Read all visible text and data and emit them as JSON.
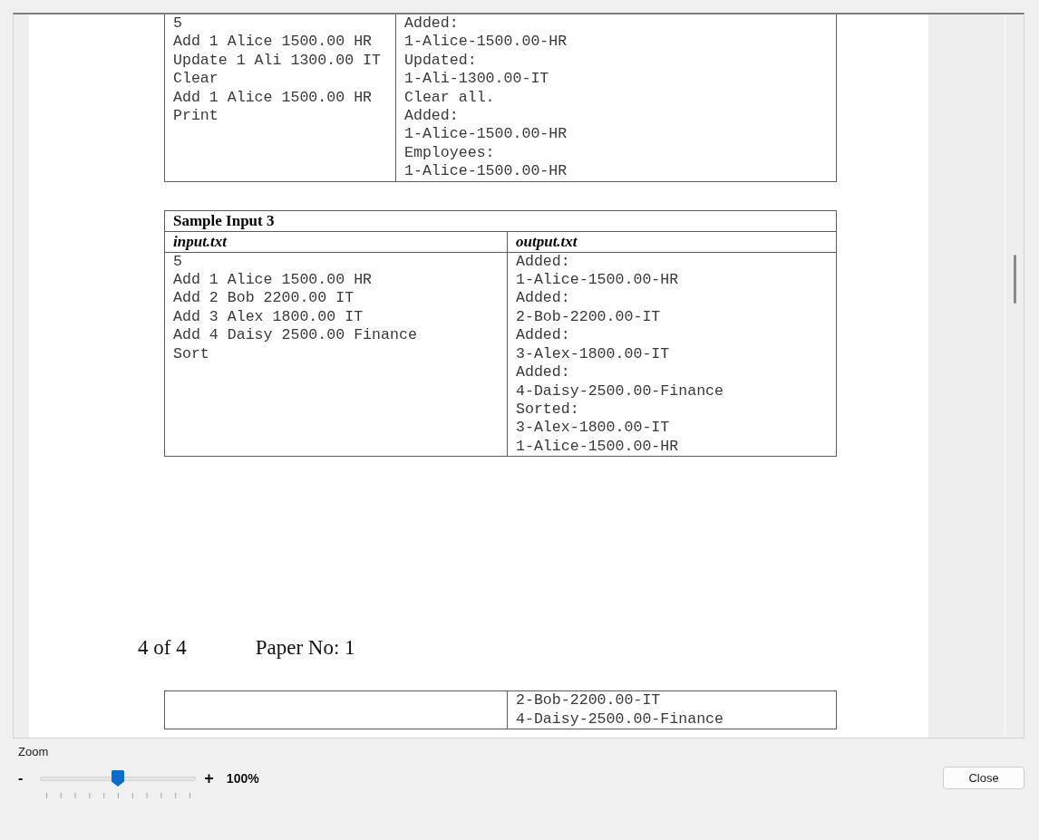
{
  "document": {
    "blocks": [
      {
        "kind": "table",
        "rows": [
          {
            "kind": "body",
            "cells": [
              {
                "lines": [
                  "5",
                  "Add 1 Alice 1500.00 HR",
                  "Update 1 Ali 1300.00 IT",
                  "Clear",
                  "Add 1 Alice 1500.00 HR",
                  "Print"
                ]
              },
              {
                "lines": [
                  "Added:",
                  "1-Alice-1500.00-HR",
                  "Updated:",
                  "1-Ali-1300.00-IT",
                  "Clear all.",
                  "Added:",
                  "1-Alice-1500.00-HR",
                  "Employees:",
                  "1-Alice-1500.00-HR"
                ]
              }
            ]
          }
        ]
      },
      {
        "kind": "table",
        "rows": [
          {
            "kind": "title",
            "text": "Sample Input 3"
          },
          {
            "kind": "header",
            "cells": [
              "input.txt",
              "output.txt"
            ]
          },
          {
            "kind": "body",
            "cells": [
              {
                "lines": [
                  "5",
                  "Add 1 Alice 1500.00 HR",
                  "Add 2 Bob 2200.00 IT",
                  "Add 3 Alex 1800.00 IT",
                  "Add 4 Daisy 2500.00 Finance",
                  "Sort"
                ]
              },
              {
                "lines": [
                  "Added:",
                  "1-Alice-1500.00-HR",
                  "Added:",
                  "2-Bob-2200.00-IT",
                  "Added:",
                  "3-Alex-1800.00-IT",
                  "Added:",
                  "4-Daisy-2500.00-Finance",
                  "Sorted:",
                  "3-Alex-1800.00-IT",
                  "1-Alice-1500.00-HR"
                ]
              }
            ]
          }
        ]
      },
      {
        "kind": "footer",
        "page": "4 of 4",
        "paper": "Paper No: 1"
      },
      {
        "kind": "table",
        "rows": [
          {
            "kind": "body",
            "cells": [
              {},
              {
                "lines": [
                  "2-Bob-2200.00-IT",
                  "4-Daisy-2500.00-Finance"
                ]
              }
            ]
          }
        ]
      }
    ]
  },
  "zoom": {
    "label": "Zoom",
    "minus": "-",
    "plus": "+",
    "level": 0.5,
    "value": "100%"
  },
  "buttons": [
    {
      "label": "Close"
    }
  ]
}
